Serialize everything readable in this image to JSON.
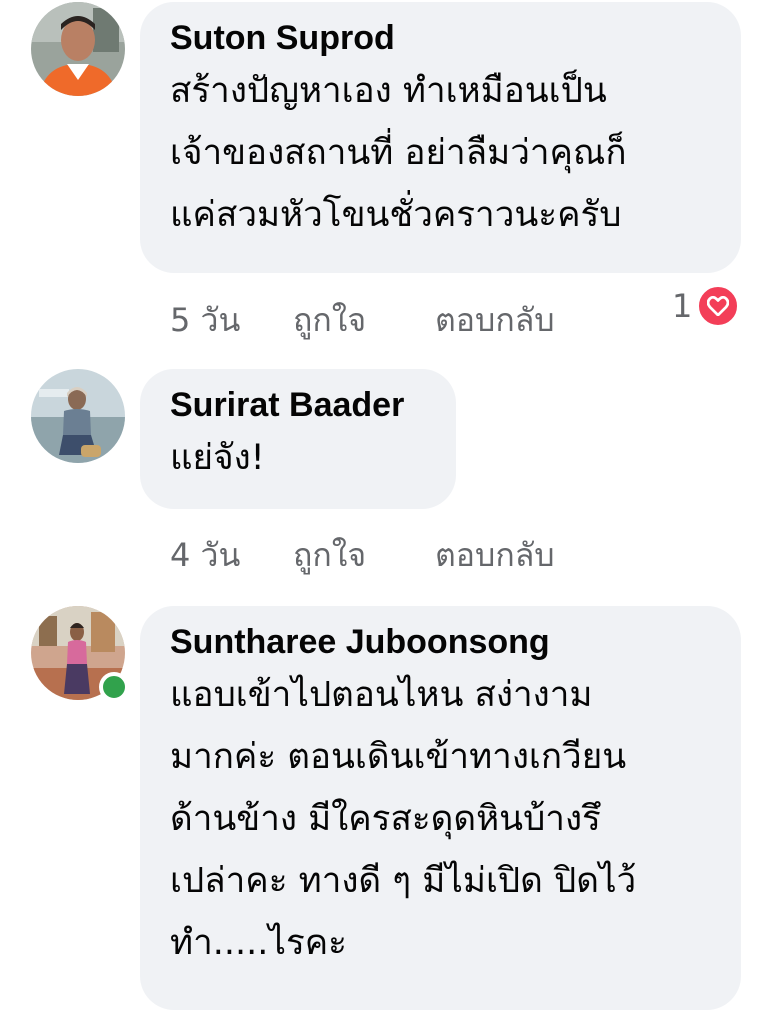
{
  "comments": [
    {
      "author": "Suton Suprod",
      "lines": [
        "สร้างปัญหาเอง ทำเหมือนเป็น",
        "เจ้าของสถานที่ อย่าลืมว่าคุณก็",
        "แค่สวมหัวโขนชั่วคราวนะครับ"
      ],
      "time": "5 วัน",
      "like_label": "ถูกใจ",
      "reply_label": "ตอบกลับ",
      "reaction_count": "1",
      "reaction_icon": "heart-icon"
    },
    {
      "author": "Surirat Baader",
      "lines": [
        "แย่จัง!"
      ],
      "time": "4 วัน",
      "like_label": "ถูกใจ",
      "reply_label": "ตอบกลับ"
    },
    {
      "author": "Suntharee Juboonsong",
      "online": true,
      "lines": [
        "แอบเข้าไปตอนไหน สง่างาม",
        "มากค่ะ  ตอนเดินเข้าทางเกวียน",
        "ด้านข้าง มีใครสะดุดหินบ้างรึ",
        "เปล่าคะ ทางดี ๆ มีไม่เปิด ปิดไว้",
        "ทำ.....ไรคะ"
      ]
    }
  ],
  "colors": {
    "bubble": "#f0f2f5",
    "meta_text": "#65676b",
    "heart": "#f33e58",
    "online": "#31a24c"
  }
}
